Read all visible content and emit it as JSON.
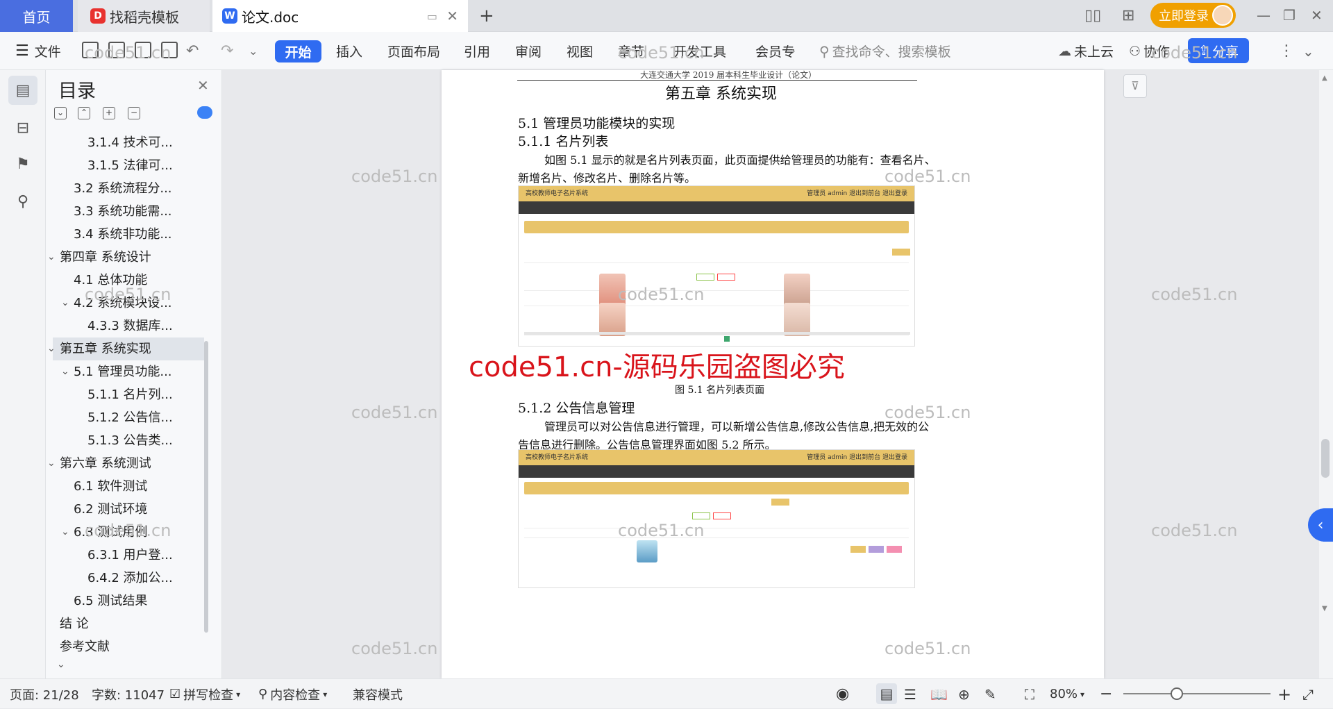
{
  "tabs": {
    "home": "首页",
    "docer": "找稻壳模板",
    "doc": "论文.doc"
  },
  "login": "立即登录",
  "toolbar": {
    "file": "文件",
    "items": [
      "开始",
      "插入",
      "页面布局",
      "引用",
      "审阅",
      "视图",
      "章节",
      "开发工具",
      "会员专"
    ],
    "search": "查找命令、搜索模板",
    "cloud": "未上云",
    "collab": "协作",
    "share": "分享"
  },
  "toc": {
    "title": "目录",
    "items": [
      {
        "label": "3.1.4 技术可...",
        "level": 3
      },
      {
        "label": "3.1.5 法律可...",
        "level": 3
      },
      {
        "label": "3.2 系统流程分...",
        "level": 2
      },
      {
        "label": "3.3 系统功能需...",
        "level": 2
      },
      {
        "label": "3.4 系统非功能...",
        "level": 2
      },
      {
        "label": "第四章  系统设计",
        "level": 1,
        "exp": true
      },
      {
        "label": "4.1  总体功能",
        "level": 2
      },
      {
        "label": "4.2  系统模块设...",
        "level": 2,
        "exp": true
      },
      {
        "label": "4.3.3  数据库...",
        "level": 3
      },
      {
        "label": "第五章  系统实现",
        "level": 1,
        "exp": true,
        "sel": true
      },
      {
        "label": "5.1  管理员功能...",
        "level": 2,
        "exp": true
      },
      {
        "label": "5.1.1  名片列...",
        "level": 3
      },
      {
        "label": "5.1.2  公告信...",
        "level": 3
      },
      {
        "label": "5.1.3  公告类...",
        "level": 3
      },
      {
        "label": "第六章  系统测试",
        "level": 1,
        "exp": true
      },
      {
        "label": "6.1 软件测试",
        "level": 2
      },
      {
        "label": "6.2 测试环境",
        "level": 2
      },
      {
        "label": "6.3  测试用例",
        "level": 2,
        "exp": true
      },
      {
        "label": "6.3.1  用户登...",
        "level": 3
      },
      {
        "label": "6.4.2  添加公...",
        "level": 3
      },
      {
        "label": "6.5 测试结果",
        "level": 2
      },
      {
        "label": "结   论",
        "level": 1
      },
      {
        "label": "参考文献",
        "level": 1
      }
    ]
  },
  "doc": {
    "header": "大连交通大学 2019 届本科生毕业设计（论文）",
    "chapter": "第五章  系统实现",
    "h51": "5.1  管理员功能模块的实现",
    "h511": "5.1.1  名片列表",
    "p1a": "如图 5.1 显示的就是名片列表页面，此页面提供给管理员的功能有：查看名片、",
    "p1b": "新增名片、修改名片、删除名片等。",
    "fig1_caption": "图 5.1  名片列表页面",
    "h512": "5.1.2  公告信息管理",
    "p2a": "管理员可以对公告信息进行管理，可以新增公告信息,修改公告信息,把无效的公",
    "p2b": "告信息进行删除。公告信息管理界面如图 5.2 所示。",
    "ss_title": "高校教师电子名片系统",
    "ss_user": "管理员 admin   退出到前台   退出登录"
  },
  "watermark": "code51.cn",
  "watermark_big": "code51.cn-源码乐园盗图必究",
  "status": {
    "page": "页面: 21/28",
    "words": "字数: 11047",
    "spell": "拼写检查",
    "content": "内容检查",
    "compat": "兼容模式",
    "zoom": "80%"
  }
}
